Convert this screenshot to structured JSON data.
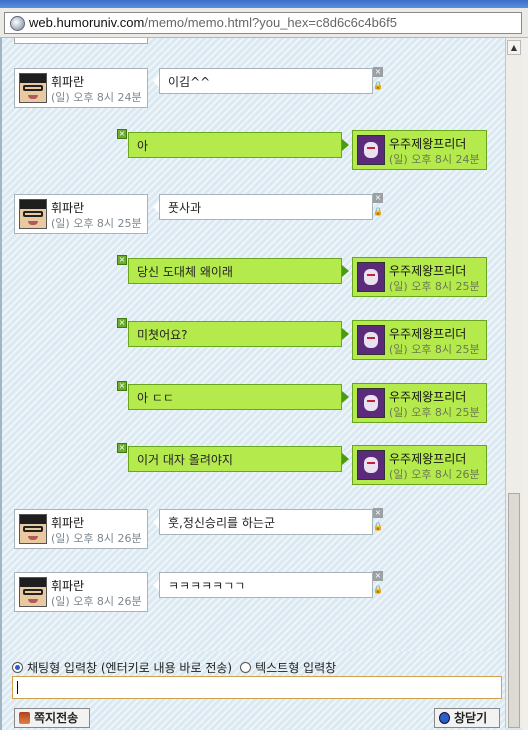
{
  "browser": {
    "url_host": "web.humoruniv.com",
    "url_path": "/memo/memo.html?you_hex=c8d6c6c4b6f5"
  },
  "messages": [
    {
      "side": "in",
      "name": "휘파란",
      "time": "(일) 오후 8시 24분",
      "text": "이김^^"
    },
    {
      "side": "out",
      "name": "우주제왕프리더",
      "time": "(일) 오후 8시 24분",
      "text": "아"
    },
    {
      "side": "in",
      "name": "휘파란",
      "time": "(일) 오후 8시 25분",
      "text": "풋사과"
    },
    {
      "side": "out",
      "name": "우주제왕프리더",
      "time": "(일) 오후 8시 25분",
      "text": "당신 도대체 왜이래"
    },
    {
      "side": "out",
      "name": "우주제왕프리더",
      "time": "(일) 오후 8시 25분",
      "text": "미쳣어요?"
    },
    {
      "side": "out",
      "name": "우주제왕프리더",
      "time": "(일) 오후 8시 25분",
      "text": "아 ㄷㄷ"
    },
    {
      "side": "out",
      "name": "우주제왕프리더",
      "time": "(일) 오후 8시 26분",
      "text": "이거 대자 올려야지"
    },
    {
      "side": "in",
      "name": "휘파란",
      "time": "(일) 오후 8시 26분",
      "text": "훗,정신승리를 하는군"
    },
    {
      "side": "in",
      "name": "휘파란",
      "time": "(일) 오후 8시 26분",
      "text": "ㅋㅋㅋㅋㅋㄱㄱ"
    }
  ],
  "input": {
    "mode_chat_label": "채팅형 입력창 (엔터키로 내용 바로 전송)",
    "mode_text_label": "텍스트형 입력창",
    "selected_mode": "chat",
    "value": ""
  },
  "buttons": {
    "send_label": "쪽지전송",
    "close_label": "창닫기"
  },
  "icons": {
    "msg_delete": "×",
    "msg_lock": "🔒",
    "msg_check": "×"
  }
}
